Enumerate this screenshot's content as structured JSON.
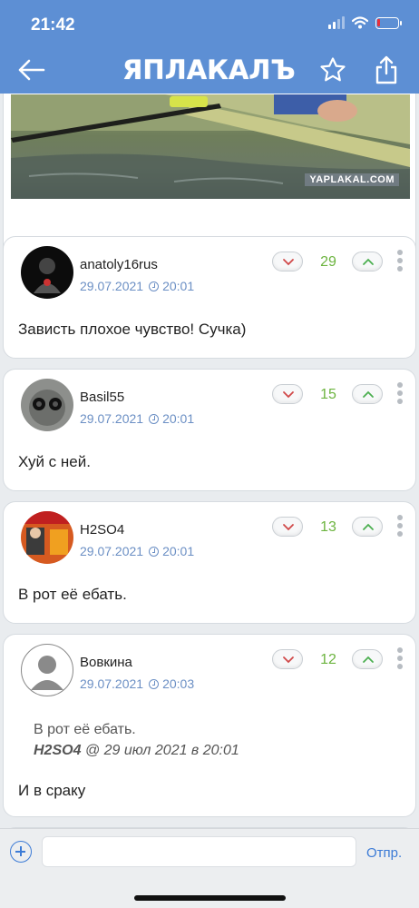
{
  "status_bar": {
    "time": "21:42",
    "battery_level": 0.15
  },
  "header": {
    "logo_text": "ЯПЛАКАЛЪ"
  },
  "media": {
    "watermark": "YAPLAKAL.COM"
  },
  "comments": [
    {
      "username": "anatoly16rus",
      "date": "29.07.2021",
      "time": "20:01",
      "score": "29",
      "text": "Зависть плохое чувство! Сучка)"
    },
    {
      "username": "Basil55",
      "date": "29.07.2021",
      "time": "20:01",
      "score": "15",
      "text": "Хуй с ней."
    },
    {
      "username": "H2SO4",
      "date": "29.07.2021",
      "time": "20:01",
      "score": "13",
      "text": "В рот её ебать."
    },
    {
      "username": "Вовкина",
      "date": "29.07.2021",
      "time": "20:03",
      "score": "12",
      "quote": {
        "text": "В рот её ебать.",
        "author": "H2SO4",
        "meta": " @ 29 июл 2021 в 20:01"
      },
      "text": "И в сраку"
    }
  ],
  "footer": {
    "input_placeholder": "",
    "send_label": "Отпр."
  },
  "colors": {
    "header": "#5d8fd4",
    "score": "#6cb43f",
    "date": "#6b8fc4",
    "accent": "#3c7bd6"
  }
}
